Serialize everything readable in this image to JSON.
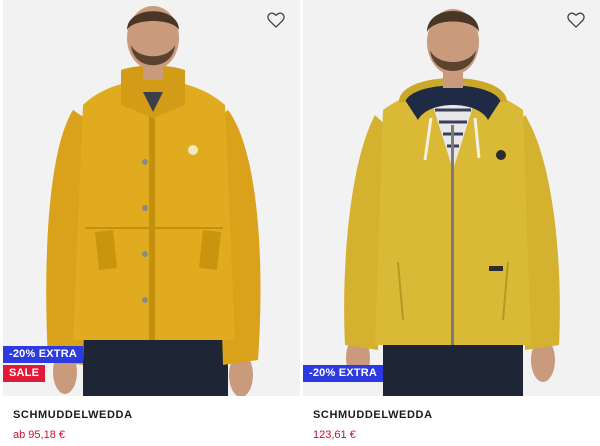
{
  "products": [
    {
      "brand": "SCHMUDDELWEDDA",
      "price": "ab 95,18 €",
      "badges": {
        "extra": "-20% EXTRA",
        "sale": "SALE"
      },
      "image_alt": "Yellow softshell jacket",
      "wishlist_icon": "heart-outline-icon"
    },
    {
      "brand": "SCHMUDDELWEDDA",
      "price": "123,61 €",
      "badges": {
        "extra": "-20% EXTRA"
      },
      "image_alt": "Yellow knit fleece hoodie jacket",
      "wishlist_icon": "heart-outline-icon"
    }
  ],
  "colors": {
    "extra_badge": "#2d3ae0",
    "sale_badge": "#e21a3a",
    "price": "#c8102e",
    "jacket_yellow": "#e0ab1f",
    "fleece_yellow": "#d9b935"
  }
}
